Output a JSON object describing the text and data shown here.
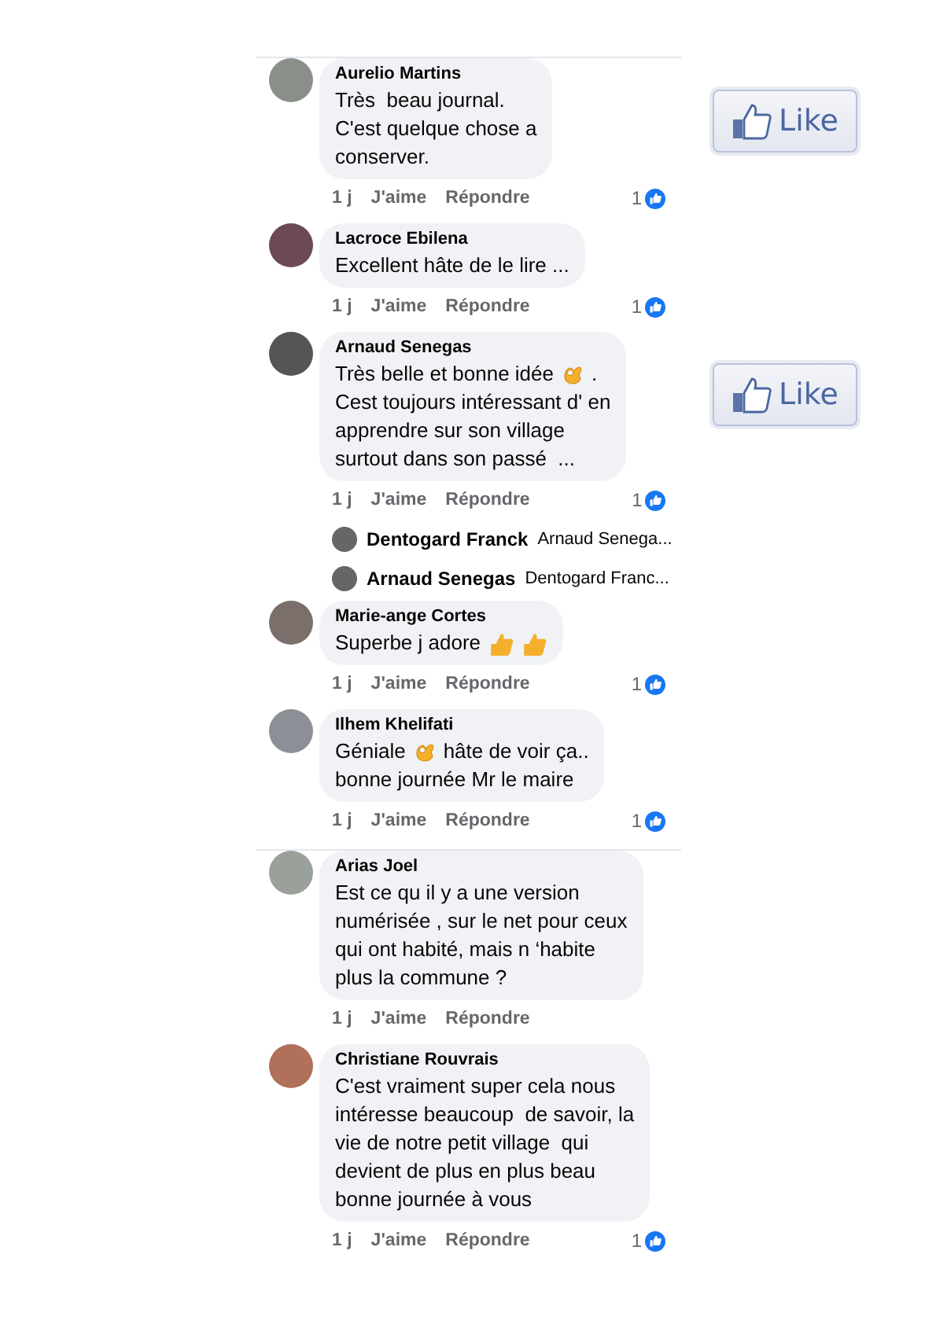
{
  "panels": [
    {
      "comments": [
        {
          "author": "Aurelio Martins",
          "lines": [
            [
              {
                "kind": "text",
                "text": "Très  beau journal."
              }
            ],
            [
              {
                "kind": "text",
                "text": "C'est quelque chose a"
              }
            ],
            [
              {
                "kind": "text",
                "text": "conserver."
              }
            ]
          ],
          "time": "1 j",
          "like_action": "J'aime",
          "reply_action": "Répondre",
          "reactions": "1",
          "like_button": "Like"
        },
        {
          "author": "Lacroce Ebilena",
          "lines": [
            [
              {
                "kind": "text",
                "text": "Excellent hâte de le lire ..."
              }
            ]
          ],
          "time": "1 j",
          "like_action": "J'aime",
          "reply_action": "Répondre",
          "reactions": "1"
        },
        {
          "author": "Arnaud Senegas",
          "lines": [
            [
              {
                "kind": "text",
                "text": "Très belle et bonne idée"
              },
              {
                "kind": "ok_hand"
              },
              {
                "kind": "text",
                "text": "."
              }
            ],
            [
              {
                "kind": "text",
                "text": "Cest toujours intéressant d' en"
              }
            ],
            [
              {
                "kind": "text",
                "text": "apprendre sur son village"
              }
            ],
            [
              {
                "kind": "text",
                "text": "surtout dans son passé  ..."
              }
            ]
          ],
          "time": "1 j",
          "like_action": "J'aime",
          "reply_action": "Répondre",
          "reactions": "1",
          "like_button": "Like",
          "replies": [
            {
              "author": "Dentogard Franck",
              "preview": "Arnaud Senega..."
            },
            {
              "author": "Arnaud Senegas",
              "preview": "Dentogard Franc..."
            }
          ]
        },
        {
          "author": "Marie-ange Cortes",
          "lines": [
            [
              {
                "kind": "text",
                "text": "Superbe j adore"
              },
              {
                "kind": "thumbs_up"
              },
              {
                "kind": "thumbs_up"
              }
            ]
          ],
          "time": "1 j",
          "like_action": "J'aime",
          "reply_action": "Répondre",
          "reactions": "1"
        },
        {
          "author": "Ilhem Khelifati",
          "lines": [
            [
              {
                "kind": "text",
                "text": "Géniale"
              },
              {
                "kind": "ok_hand"
              },
              {
                "kind": "text",
                "text": "hâte de voir ça.."
              }
            ],
            [
              {
                "kind": "text",
                "text": "bonne journée Mr le maire"
              }
            ]
          ],
          "time": "1 j",
          "like_action": "J'aime",
          "reply_action": "Répondre",
          "reactions": "1"
        }
      ]
    },
    {
      "comments": [
        {
          "author": "Arias Joel",
          "lines": [
            [
              {
                "kind": "text",
                "text": "Est ce qu il y a une version"
              }
            ],
            [
              {
                "kind": "text",
                "text": "numérisée , sur le net pour ceux"
              }
            ],
            [
              {
                "kind": "text",
                "text": "qui ont habité, mais n ‘habite"
              }
            ],
            [
              {
                "kind": "text",
                "text": "plus la commune ?"
              }
            ]
          ],
          "time": "1 j",
          "like_action": "J'aime",
          "reply_action": "Répondre"
        },
        {
          "author": "Christiane Rouvrais",
          "lines": [
            [
              {
                "kind": "text",
                "text": "C'est vraiment super cela nous"
              }
            ],
            [
              {
                "kind": "text",
                "text": "intéresse beaucoup  de savoir, la"
              }
            ],
            [
              {
                "kind": "text",
                "text": "vie de notre petit village  qui"
              }
            ],
            [
              {
                "kind": "text",
                "text": "devient de plus en plus beau"
              }
            ],
            [
              {
                "kind": "text",
                "text": "bonne journée à vous"
              }
            ]
          ],
          "time": "1 j",
          "like_action": "J'aime",
          "reply_action": "Répondre",
          "reactions": "1"
        }
      ]
    }
  ]
}
